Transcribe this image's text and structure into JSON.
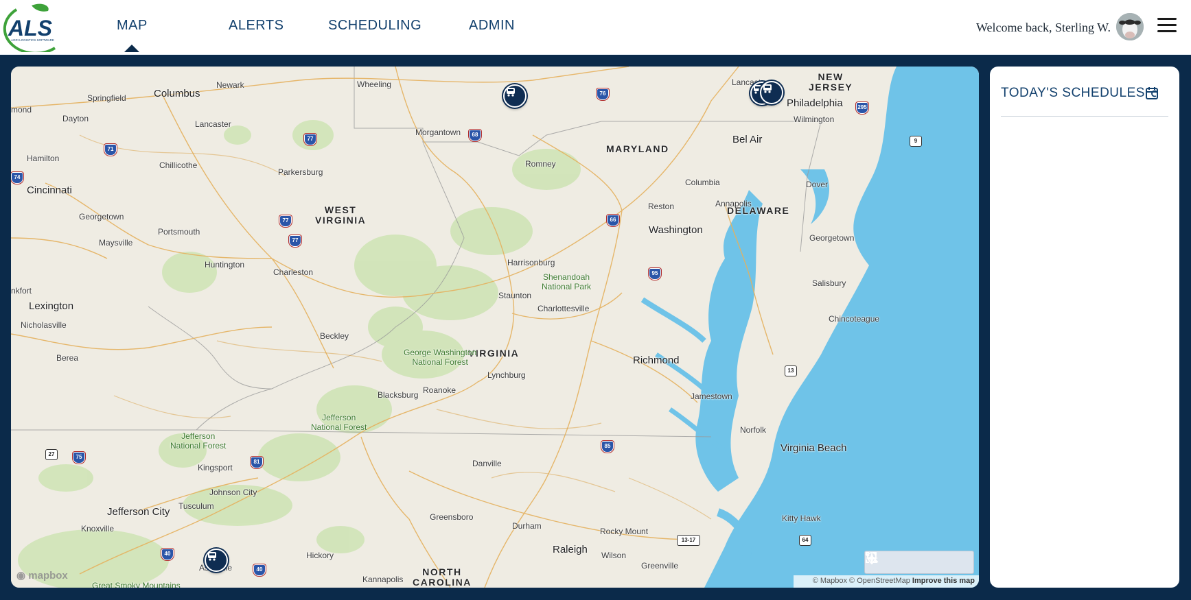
{
  "app": {
    "logo_text": "ALS",
    "logo_subtitle": "AGRI LOGISTICS SOFTWARE",
    "brand_color": "#12406d",
    "accent_green": "#3ea23a"
  },
  "nav": {
    "items": [
      {
        "label": "MAP",
        "active": true
      },
      {
        "label": "ALERTS"
      },
      {
        "label": "SCHEDULING"
      },
      {
        "label": "ADMIN"
      }
    ]
  },
  "user": {
    "welcome": "Welcome back, Sterling W.",
    "avatar_icon": "cow-avatar"
  },
  "map": {
    "states": [
      {
        "id": "wv",
        "label": "WEST\nVIRGINIA"
      },
      {
        "id": "va",
        "label": "VIRGINIA"
      },
      {
        "id": "md",
        "label": "MARYLAND"
      },
      {
        "id": "de",
        "label": "DELAWARE"
      },
      {
        "id": "nj",
        "label": "NEW\nJERSEY"
      },
      {
        "id": "nc",
        "label": "NORTH\nCAROLINA"
      }
    ],
    "cities": [
      "Columbus",
      "Newark",
      "Wheeling",
      "Springfield",
      "Dayton",
      "Lancaster",
      "Morgantown",
      "Romney",
      "Hamilton",
      "Chillicothe",
      "Parkersburg",
      "Cincinnati",
      "Georgetown",
      "Portsmouth",
      "Maysville",
      "Huntington",
      "Charleston",
      "Lexington",
      "Nicholasville",
      "Berea",
      "Beckley",
      "Blacksburg",
      "Roanoke",
      "Lynchburg",
      "Harrisonburg",
      "Staunton",
      "Charlottesville",
      "Richmond",
      "Washington",
      "Reston",
      "Columbia",
      "Annapolis",
      "Bel Air",
      "Philadelphia",
      "Wilmington",
      "Dover",
      "Georgetown",
      "Salisbury",
      "Chincoteague",
      "Jamestown",
      "Norfolk",
      "Virginia Beach",
      "Kitty Hawk",
      "Danville",
      "Greensboro",
      "Durham",
      "Raleigh",
      "Rocky Mount",
      "Wilson",
      "Greenville",
      "Kingsport",
      "Johnson City",
      "Jefferson City",
      "Tusculum",
      "Knoxville",
      "Hickory",
      "Kannapolis",
      "Asheville",
      "Lancaster",
      "mond",
      "nkfort"
    ],
    "parks": [
      "Shenandoah\nNational Park",
      "George Washington\nNational Forest",
      "Jefferson\nNational Forest",
      "Jefferson\nNational Forest",
      "Great Smoky Mountains"
    ],
    "interstates": [
      "71",
      "77",
      "68",
      "76",
      "66",
      "77",
      "77",
      "95",
      "74",
      "295",
      "81",
      "75",
      "40",
      "40",
      "85",
      "9",
      "13",
      "64",
      "27",
      "13-17"
    ],
    "markers": [
      {
        "name": "truck-marker-pa"
      },
      {
        "name": "truck-marker-lancaster-a"
      },
      {
        "name": "truck-marker-lancaster-b"
      },
      {
        "name": "truck-marker-asheville"
      }
    ],
    "attribution": "© Mapbox © OpenStreetMap",
    "improve": "Improve this map",
    "mapbox_logo": "mapbox",
    "tools": [
      {
        "name": "location-pin-icon"
      },
      {
        "name": "satellite-icon"
      },
      {
        "name": "fullscreen-icon"
      },
      {
        "name": "compass-icon"
      }
    ],
    "colors": {
      "land": "#efece3",
      "water": "#6fc3e8",
      "forest": "#c5dfae",
      "road": "#e8b25a"
    }
  },
  "panel": {
    "title": "TODAY'S SCHEDULES",
    "icon": "calendar-refresh-icon"
  }
}
